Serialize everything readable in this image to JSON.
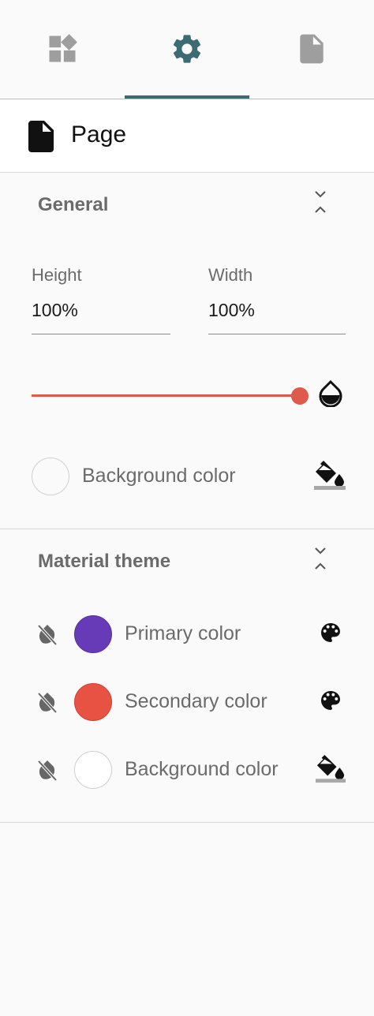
{
  "tabs": [
    {
      "name": "widgets",
      "icon": "widgets-icon",
      "color": "#9e9e9e"
    },
    {
      "name": "settings",
      "icon": "gear-icon",
      "color": "#3d6b73",
      "active": true
    },
    {
      "name": "page",
      "icon": "document-icon",
      "color": "#9e9e9e"
    }
  ],
  "header": {
    "title": "Page",
    "icon": "document-icon"
  },
  "general": {
    "title": "General",
    "height_label": "Height",
    "height_value": "100%",
    "width_label": "Width",
    "width_value": "100%",
    "opacity": 1.0,
    "accent_color": "#e05a4b",
    "background_label": "Background color",
    "background_color": "#ffffff"
  },
  "material_theme": {
    "title": "Material theme",
    "rows": [
      {
        "label": "Primary color",
        "color": "#673ab7",
        "action_icon": "palette-icon"
      },
      {
        "label": "Secondary color",
        "color": "#e85242",
        "action_icon": "palette-icon"
      },
      {
        "label": "Background color",
        "color": "#ffffff",
        "action_icon": "paint-bucket-icon"
      }
    ]
  }
}
